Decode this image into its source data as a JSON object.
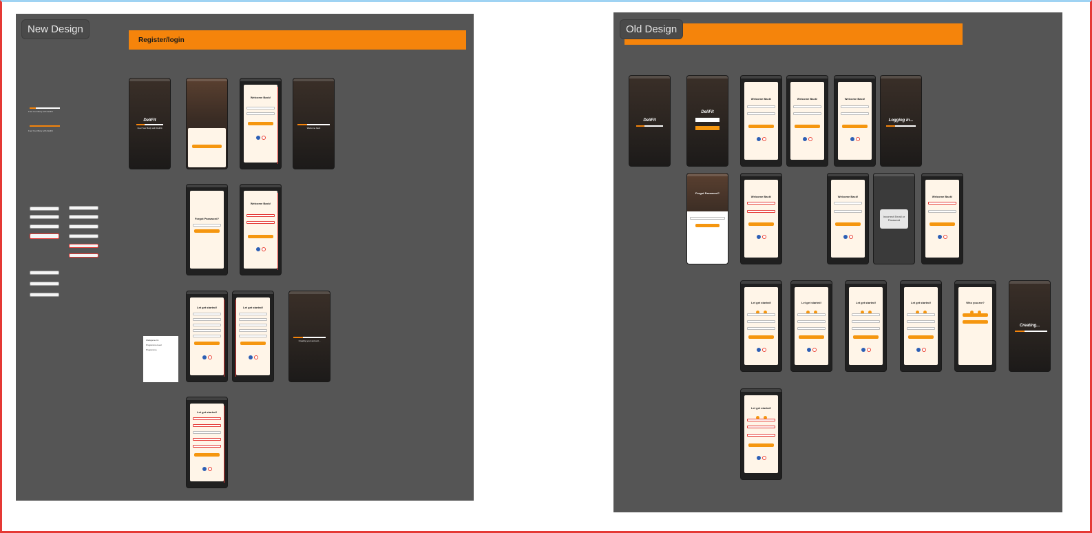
{
  "boards": {
    "new_design_label": "New Design",
    "old_design_label": "Old Design",
    "new_banner_label": "Register/login"
  },
  "splash": {
    "brand": "DeliFit",
    "tagline": "Fuel Your Body with DeliFit",
    "welcome_back": "Welcome back",
    "logging_in": "Logging in...",
    "creating_account": "Creating your account...",
    "creating": "Creating..."
  },
  "screens": {
    "welcome_title": "Welcome Back!",
    "forgot_title": "Forgot Password?",
    "get_started_title": "Let get started!",
    "who_title": "Who you are?",
    "incorrect_msg": "Incorrect Email or Password"
  },
  "note": {
    "lines": [
      "Welkgame Int",
      "Programme level",
      "Programme"
    ]
  },
  "colors": {
    "accent": "#f5840b",
    "board_bg": "#555555",
    "screen_bg": "#fff5e8",
    "error": "#e53935"
  }
}
